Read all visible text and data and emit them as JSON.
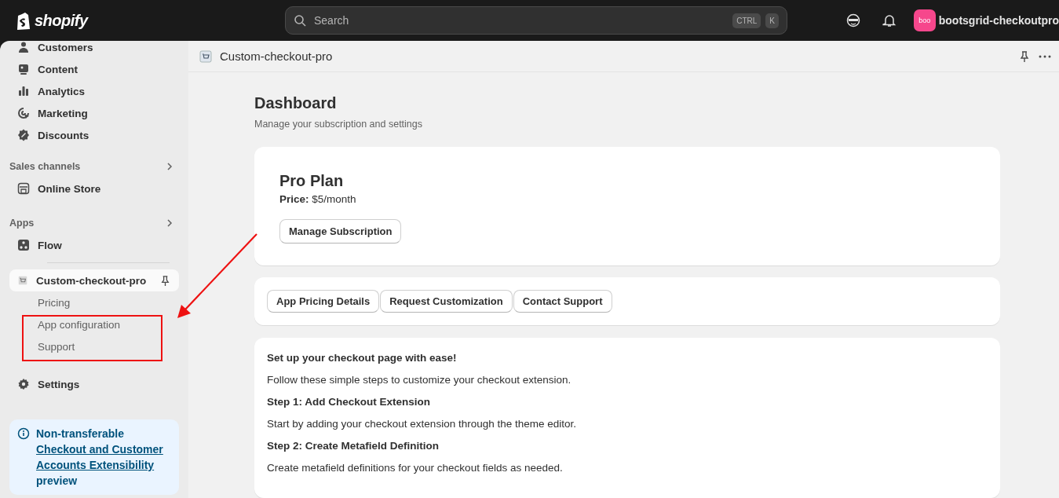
{
  "top_bar": {
    "logo": "shopify",
    "search": {
      "placeholder": "Search",
      "keys": [
        "CTRL",
        "K"
      ]
    },
    "store": {
      "avatar": "boo",
      "name": "bootsgrid-checkoutpro"
    }
  },
  "sidebar": {
    "items": [
      {
        "label": "Customers",
        "selected": false
      },
      {
        "label": "Content",
        "selected": false
      },
      {
        "label": "Analytics",
        "selected": false
      },
      {
        "label": "Marketing",
        "selected": false
      },
      {
        "label": "Discounts",
        "selected": false
      }
    ],
    "sales_channels": {
      "heading": "Sales channels",
      "items": [
        {
          "label": "Online Store",
          "selected": false
        }
      ]
    },
    "apps": {
      "heading": "Apps",
      "items": [
        {
          "label": "Flow",
          "selected": false
        }
      ],
      "pinned_app": {
        "label": "Custom-checkout-pro",
        "selected": true,
        "children": [
          {
            "label": "Pricing",
            "selected": false
          },
          {
            "label": "App configuration",
            "selected": false
          },
          {
            "label": "Support",
            "selected": false
          }
        ]
      }
    },
    "settings": {
      "label": "Settings",
      "selected": false
    },
    "notice": {
      "title": "Non-transferable",
      "link": "Checkout and Customer Accounts Extensibility",
      "suffix": "preview"
    }
  },
  "app_header": {
    "title": "Custom-checkout-pro"
  },
  "page": {
    "title": "Dashboard",
    "subtitle": "Manage your subscription and settings"
  },
  "plan_card": {
    "name": "Pro Plan",
    "price": "**Price:** $5/month",
    "button": "Manage Subscription"
  },
  "link_buttons": [
    "App Pricing Details",
    "Request Customization",
    "Contact Support"
  ],
  "setup_card": {
    "title": "Set up your checkout page with ease!",
    "intro": "Follow these simple steps to customize your checkout extension.",
    "steps": [
      {
        "title": "Step 1: Add Checkout Extension",
        "text": "Start by adding your checkout extension through the theme editor."
      },
      {
        "title": "Step 2: Create Metafield Definition",
        "text": "Create metafield definitions for your checkout fields as needed."
      }
    ]
  }
}
